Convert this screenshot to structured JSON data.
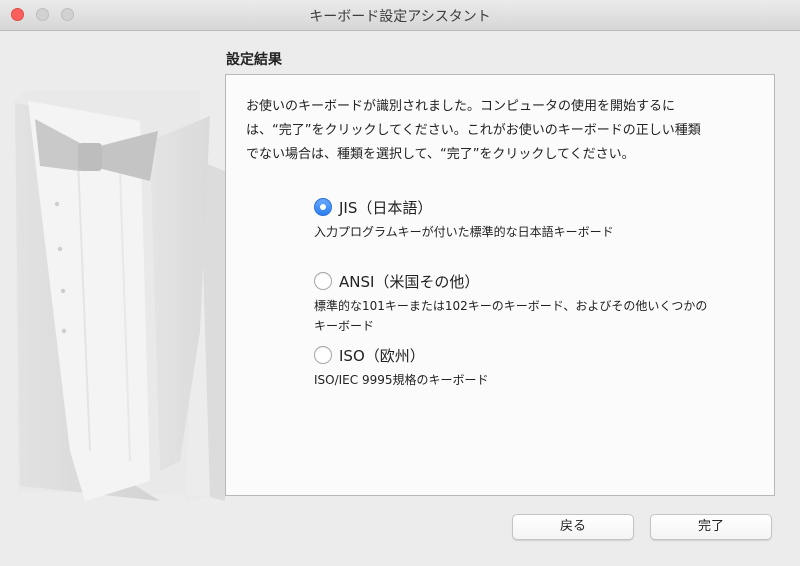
{
  "window": {
    "title": "キーボード設定アシスタント"
  },
  "section": {
    "title": "設定結果"
  },
  "intro": {
    "lines": [
      "お使いのキーボードが識別されました。コンピュータの使用を開始するに",
      "は、“完了”をクリックしてください。これがお使いのキーボードの正しい種類",
      "でない場合は、種類を選択して、“完了”をクリックしてください。"
    ]
  },
  "options": [
    {
      "label": "JIS（日本語）",
      "selected": true,
      "description": [
        "入力プログラムキーが付いた標準的な日本語キーボード"
      ]
    },
    {
      "label": "ANSI（米国その他）",
      "selected": false,
      "description": [
        "標準的な101キーまたは102キーのキーボード、およびその他いくつかの",
        "キーボード"
      ]
    },
    {
      "label": "ISO（欧州）",
      "selected": false,
      "description": [
        "ISO/IEC 9995規格のキーボード"
      ]
    }
  ],
  "buttons": {
    "back": "戻る",
    "done": "完了"
  },
  "colors": {
    "accent": "#2a7df0",
    "close": "#fc605c"
  }
}
